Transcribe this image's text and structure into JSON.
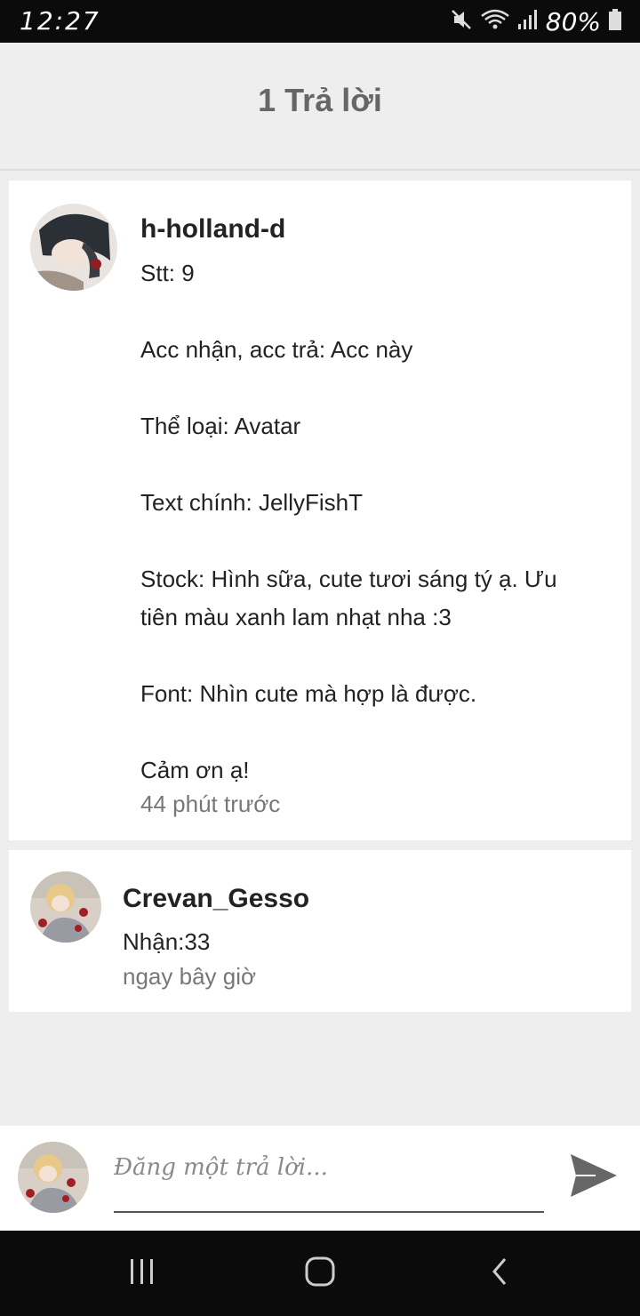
{
  "status_bar": {
    "time": "12:27",
    "battery": "80%",
    "icons": [
      "mute-icon",
      "wifi-icon",
      "signal-icon",
      "battery-icon"
    ]
  },
  "header": {
    "title": "1 Trả lời"
  },
  "post": {
    "username": "h-holland-d",
    "lines": [
      "Stt: 9",
      "Acc nhận, acc trả: Acc này",
      "Thể loại: Avatar",
      "Text chính: JellyFishT",
      "Stock: Hình sữa, cute tươi sáng tý ạ. Ưu",
      "tiên màu xanh lam nhạt nha :3",
      "Font: Nhìn cute mà hợp là được.",
      "Cảm ơn ạ!"
    ],
    "time": "44 phút trước"
  },
  "reply": {
    "username": "Crevan_Gesso",
    "text": "Nhận:33",
    "time": "ngay bây giờ"
  },
  "composer": {
    "placeholder": "Đăng một trả lời..."
  },
  "nav": {
    "icons": [
      "recent-apps-icon",
      "home-icon",
      "back-icon"
    ]
  },
  "colors": {
    "background": "#eeeeee",
    "card": "#ffffff",
    "system_bar": "#0b0b0b",
    "header_text": "#666666",
    "muted_text": "#777777"
  }
}
